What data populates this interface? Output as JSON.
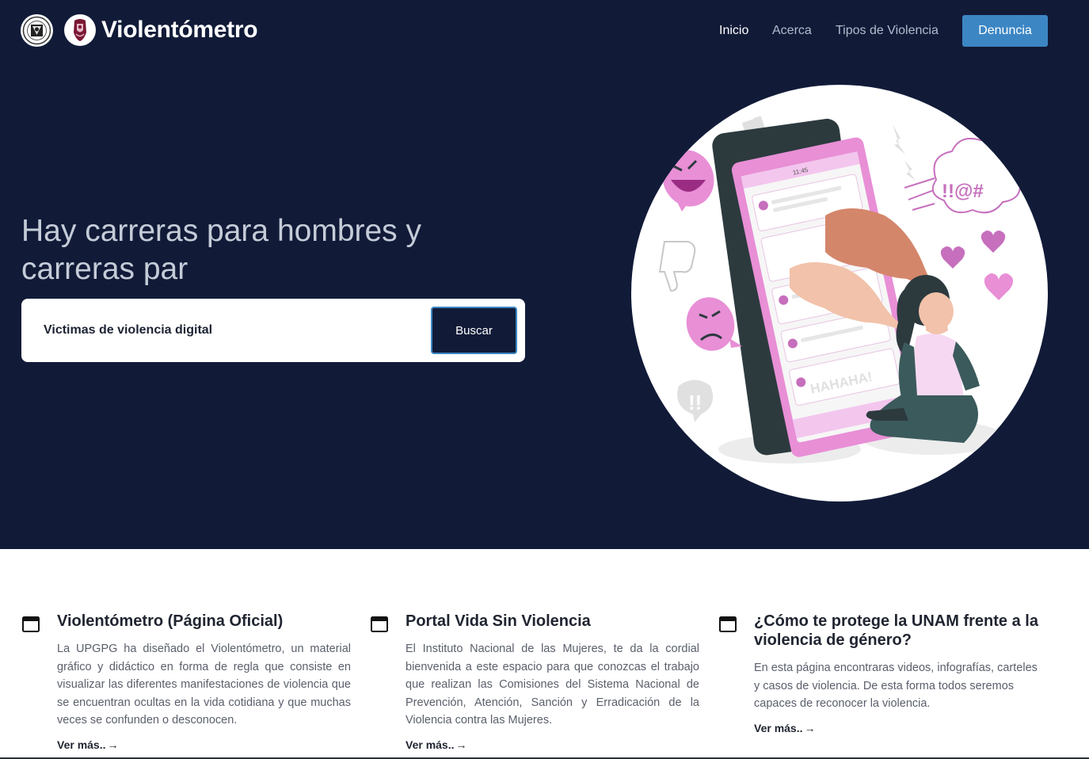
{
  "brand": {
    "name": "Violentómetro"
  },
  "nav": {
    "items": [
      {
        "label": "Inicio",
        "active": true
      },
      {
        "label": "Acerca",
        "active": false
      },
      {
        "label": "Tipos de Violencia",
        "active": false
      }
    ],
    "cta_label": "Denuncia"
  },
  "hero": {
    "title": "Hay carreras para hombres y carreras par",
    "search_value": "Victimas de violencia digital",
    "search_button": "Buscar",
    "illustration_texts": {
      "phone_time": "11:45",
      "laugh": "HAHAHA!",
      "symbols": "!!@#"
    }
  },
  "cards": [
    {
      "title": "Violentómetro (Página Oficial)",
      "text": "La UPGPG ha diseñado el Violentómetro, un material gráfico y didáctico en forma de regla que consiste en visualizar las diferentes manifestaciones de violencia que se encuentran ocultas en la vida cotidiana y que muchas veces se confunden o desconocen.",
      "link": "Ver más.."
    },
    {
      "title": "Portal Vida Sin Violencia",
      "text": "El Instituto Nacional de las Mujeres, te da la cordial bienvenida a este espacio para que conozcas el trabajo que realizan las Comisiones del Sistema Nacional de Prevención, Atención, Sanción y Erradicación de la Violencia contra las Mujeres.",
      "link": "Ver más.."
    },
    {
      "title": "¿Cómo te protege la UNAM frente a la violencia de género?",
      "text": "En esta página encontraras videos, infografías, carteles y casos de violencia. De esta forma todos seremos capaces de reconocer la violencia.",
      "link": "Ver más.."
    }
  ],
  "colors": {
    "hero_bg": "#111b38",
    "accent": "#3c86c4",
    "illustration_pink": "#e88fd6"
  }
}
